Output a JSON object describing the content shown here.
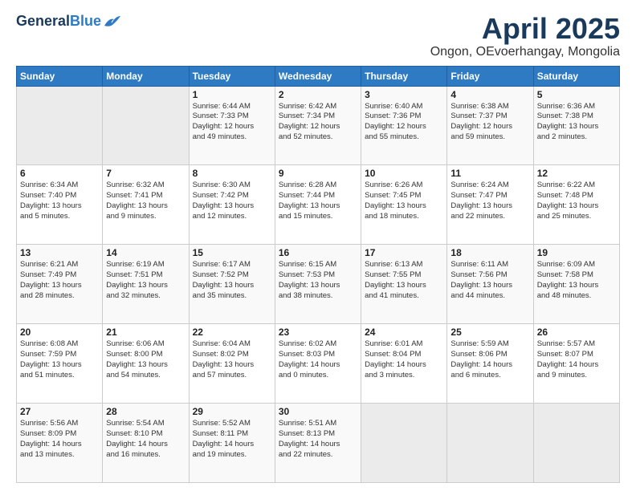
{
  "header": {
    "logo_general": "General",
    "logo_blue": "Blue",
    "month_title": "April 2025",
    "location": "Ongon, OEvoerhangay, Mongolia"
  },
  "weekdays": [
    "Sunday",
    "Monday",
    "Tuesday",
    "Wednesday",
    "Thursday",
    "Friday",
    "Saturday"
  ],
  "weeks": [
    [
      {
        "day": "",
        "info": ""
      },
      {
        "day": "",
        "info": ""
      },
      {
        "day": "1",
        "info": "Sunrise: 6:44 AM\nSunset: 7:33 PM\nDaylight: 12 hours\nand 49 minutes."
      },
      {
        "day": "2",
        "info": "Sunrise: 6:42 AM\nSunset: 7:34 PM\nDaylight: 12 hours\nand 52 minutes."
      },
      {
        "day": "3",
        "info": "Sunrise: 6:40 AM\nSunset: 7:36 PM\nDaylight: 12 hours\nand 55 minutes."
      },
      {
        "day": "4",
        "info": "Sunrise: 6:38 AM\nSunset: 7:37 PM\nDaylight: 12 hours\nand 59 minutes."
      },
      {
        "day": "5",
        "info": "Sunrise: 6:36 AM\nSunset: 7:38 PM\nDaylight: 13 hours\nand 2 minutes."
      }
    ],
    [
      {
        "day": "6",
        "info": "Sunrise: 6:34 AM\nSunset: 7:40 PM\nDaylight: 13 hours\nand 5 minutes."
      },
      {
        "day": "7",
        "info": "Sunrise: 6:32 AM\nSunset: 7:41 PM\nDaylight: 13 hours\nand 9 minutes."
      },
      {
        "day": "8",
        "info": "Sunrise: 6:30 AM\nSunset: 7:42 PM\nDaylight: 13 hours\nand 12 minutes."
      },
      {
        "day": "9",
        "info": "Sunrise: 6:28 AM\nSunset: 7:44 PM\nDaylight: 13 hours\nand 15 minutes."
      },
      {
        "day": "10",
        "info": "Sunrise: 6:26 AM\nSunset: 7:45 PM\nDaylight: 13 hours\nand 18 minutes."
      },
      {
        "day": "11",
        "info": "Sunrise: 6:24 AM\nSunset: 7:47 PM\nDaylight: 13 hours\nand 22 minutes."
      },
      {
        "day": "12",
        "info": "Sunrise: 6:22 AM\nSunset: 7:48 PM\nDaylight: 13 hours\nand 25 minutes."
      }
    ],
    [
      {
        "day": "13",
        "info": "Sunrise: 6:21 AM\nSunset: 7:49 PM\nDaylight: 13 hours\nand 28 minutes."
      },
      {
        "day": "14",
        "info": "Sunrise: 6:19 AM\nSunset: 7:51 PM\nDaylight: 13 hours\nand 32 minutes."
      },
      {
        "day": "15",
        "info": "Sunrise: 6:17 AM\nSunset: 7:52 PM\nDaylight: 13 hours\nand 35 minutes."
      },
      {
        "day": "16",
        "info": "Sunrise: 6:15 AM\nSunset: 7:53 PM\nDaylight: 13 hours\nand 38 minutes."
      },
      {
        "day": "17",
        "info": "Sunrise: 6:13 AM\nSunset: 7:55 PM\nDaylight: 13 hours\nand 41 minutes."
      },
      {
        "day": "18",
        "info": "Sunrise: 6:11 AM\nSunset: 7:56 PM\nDaylight: 13 hours\nand 44 minutes."
      },
      {
        "day": "19",
        "info": "Sunrise: 6:09 AM\nSunset: 7:58 PM\nDaylight: 13 hours\nand 48 minutes."
      }
    ],
    [
      {
        "day": "20",
        "info": "Sunrise: 6:08 AM\nSunset: 7:59 PM\nDaylight: 13 hours\nand 51 minutes."
      },
      {
        "day": "21",
        "info": "Sunrise: 6:06 AM\nSunset: 8:00 PM\nDaylight: 13 hours\nand 54 minutes."
      },
      {
        "day": "22",
        "info": "Sunrise: 6:04 AM\nSunset: 8:02 PM\nDaylight: 13 hours\nand 57 minutes."
      },
      {
        "day": "23",
        "info": "Sunrise: 6:02 AM\nSunset: 8:03 PM\nDaylight: 14 hours\nand 0 minutes."
      },
      {
        "day": "24",
        "info": "Sunrise: 6:01 AM\nSunset: 8:04 PM\nDaylight: 14 hours\nand 3 minutes."
      },
      {
        "day": "25",
        "info": "Sunrise: 5:59 AM\nSunset: 8:06 PM\nDaylight: 14 hours\nand 6 minutes."
      },
      {
        "day": "26",
        "info": "Sunrise: 5:57 AM\nSunset: 8:07 PM\nDaylight: 14 hours\nand 9 minutes."
      }
    ],
    [
      {
        "day": "27",
        "info": "Sunrise: 5:56 AM\nSunset: 8:09 PM\nDaylight: 14 hours\nand 13 minutes."
      },
      {
        "day": "28",
        "info": "Sunrise: 5:54 AM\nSunset: 8:10 PM\nDaylight: 14 hours\nand 16 minutes."
      },
      {
        "day": "29",
        "info": "Sunrise: 5:52 AM\nSunset: 8:11 PM\nDaylight: 14 hours\nand 19 minutes."
      },
      {
        "day": "30",
        "info": "Sunrise: 5:51 AM\nSunset: 8:13 PM\nDaylight: 14 hours\nand 22 minutes."
      },
      {
        "day": "",
        "info": ""
      },
      {
        "day": "",
        "info": ""
      },
      {
        "day": "",
        "info": ""
      }
    ]
  ]
}
